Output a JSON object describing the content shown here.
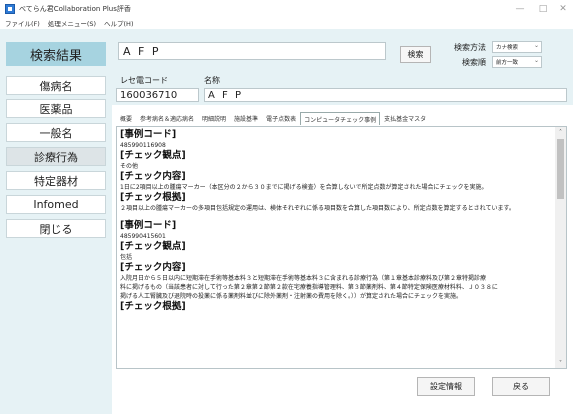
{
  "window": {
    "title": "べてらん君Collaboration Plus評香",
    "minimize": "—",
    "maximize": "□",
    "close": "✕"
  },
  "menu": [
    "ファイル(F)",
    "処理メニュー(S)",
    "ヘルプ(H)"
  ],
  "sidebar": {
    "header": "検索結果",
    "items": [
      {
        "label": "傷病名"
      },
      {
        "label": "医薬品"
      },
      {
        "label": "一般名"
      },
      {
        "label": "診療行為"
      },
      {
        "label": "特定器材"
      },
      {
        "label": "Infomed"
      },
      {
        "label": "閉じる"
      }
    ]
  },
  "search": {
    "query": "A F P",
    "button": "検索",
    "method_label": "検索方法",
    "method_value": "カナ検索",
    "order_label": "検索順",
    "order_value": "前方一致"
  },
  "record": {
    "code_label": "レセ電コード",
    "code_value": "160036710",
    "name_label": "名称",
    "name_value": "A F P"
  },
  "tabs": [
    "概要",
    "参考病名＆適応病名",
    "明細説明",
    "施設基準",
    "電子点数表",
    "コンピュータチェック事例",
    "支払基金マスタ"
  ],
  "active_tab": "コンピュータチェック事例",
  "content": {
    "case1": {
      "code_head": "[事例コード]",
      "code": "485990116908",
      "viewpoint_head": "[チェック観点]",
      "viewpoint": "その他",
      "detail_head": "[チェック内容]",
      "detail": "1日に2項目以上の腫瘍マーカー（本区分の２から３０までに掲げる検査）を合算しないで所定点数が算定された場合にチェックを実施。",
      "basis_head": "[チェック根拠]",
      "basis": "２項目以上の腫瘍マーカーの多項目包括規定の運用は、検体それぞれに係る項目数を合算した項目数により、所定点数を算定するとされています。"
    },
    "case2": {
      "code_head": "[事例コード]",
      "code": "485990415601",
      "viewpoint_head": "[チェック観点]",
      "viewpoint": "包括",
      "detail_head": "[チェック内容]",
      "detail_lines": [
        "入院月日から５日以内に短期滞在手術等基本料３と短期滞在手術等基本料３に含まれる診療行為（第１章基本診療料及び第２章特掲診療",
        "料に掲げるもの（当該患者に対して行った第２章第２節第２款在宅療養指導管理料、第３節薬剤料、第４節特定保険医療材料料、Ｊ０３８に",
        "掲げる人工腎臓及び退院時の投薬に係る薬剤料並びに除外薬剤・注射薬の費用を除く。））が算定された場合にチェックを実施。"
      ],
      "basis_head": "[チェック根拠]"
    }
  },
  "scroll": {
    "up": "˄",
    "down": "˅"
  },
  "footer": {
    "settings_button": "設定情報",
    "back_button": "戻る"
  }
}
